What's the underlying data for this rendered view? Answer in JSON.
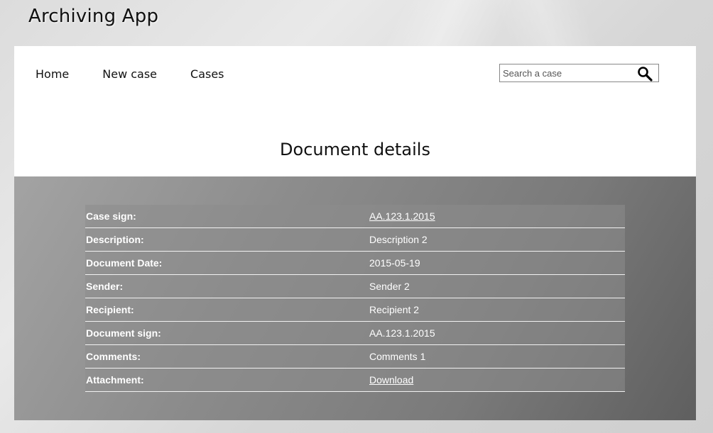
{
  "app": {
    "title": "Archiving App"
  },
  "nav": {
    "items": [
      {
        "label": "Home"
      },
      {
        "label": "New case"
      },
      {
        "label": "Cases"
      }
    ]
  },
  "search": {
    "placeholder": "Search a case",
    "value": "",
    "icon": "magnifier-icon"
  },
  "page": {
    "title": "Document details"
  },
  "details": {
    "rows": [
      {
        "label": "Case sign:",
        "value": "AA.123.1.2015",
        "link": true
      },
      {
        "label": "Description:",
        "value": "Description 2",
        "link": false
      },
      {
        "label": "Document Date:",
        "value": "2015-05-19",
        "link": false
      },
      {
        "label": "Sender:",
        "value": "Sender 2",
        "link": false
      },
      {
        "label": "Recipient:",
        "value": "Recipient 2",
        "link": false
      },
      {
        "label": "Document sign:",
        "value": "AA.123.1.2015",
        "link": false
      },
      {
        "label": "Comments:",
        "value": "Comments 1",
        "link": false
      },
      {
        "label": "Attachment:",
        "value": "Download",
        "link": true
      }
    ]
  }
}
